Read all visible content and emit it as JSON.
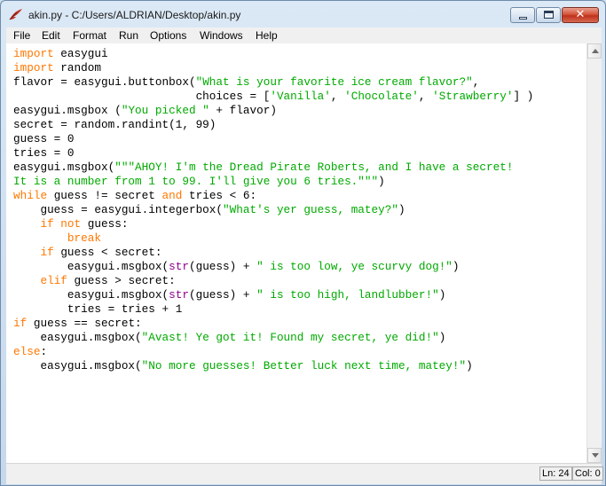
{
  "window": {
    "title": "akin.py - C:/Users/ALDRIAN/Desktop/akin.py",
    "app_icon": "idle-feather-icon",
    "controls": {
      "minimize": "minimize-icon",
      "maximize": "maximize-icon",
      "close": "close-icon"
    }
  },
  "menubar": {
    "items": [
      "File",
      "Edit",
      "Format",
      "Run",
      "Options",
      "Windows",
      "Help"
    ]
  },
  "editor": {
    "colors": {
      "keyword": "#ff7700",
      "string": "#00aa00",
      "builtin": "#900090",
      "default": "#000000"
    },
    "lines": [
      [
        [
          "kw",
          "import"
        ],
        [
          "t",
          " easygui"
        ]
      ],
      [
        [
          "kw",
          "import"
        ],
        [
          "t",
          " random"
        ]
      ],
      [
        [
          "t",
          "flavor = easygui.buttonbox("
        ],
        [
          "st",
          "\"What is your favorite ice cream flavor?\""
        ],
        [
          "t",
          ","
        ]
      ],
      [
        [
          "t",
          "                           choices = ["
        ],
        [
          "st",
          "'Vanilla'"
        ],
        [
          "t",
          ", "
        ],
        [
          "st",
          "'Chocolate'"
        ],
        [
          "t",
          ", "
        ],
        [
          "st",
          "'Strawberry'"
        ],
        [
          "t",
          "] )"
        ]
      ],
      [
        [
          "t",
          "easygui.msgbox ("
        ],
        [
          "st",
          "\"You picked \""
        ],
        [
          "t",
          " + flavor)"
        ]
      ],
      [
        [
          "t",
          "secret = random.randint(1, 99)"
        ]
      ],
      [
        [
          "t",
          "guess = 0"
        ]
      ],
      [
        [
          "t",
          "tries = 0"
        ]
      ],
      [
        [
          "t",
          "easygui.msgbox("
        ],
        [
          "st",
          "\"\"\"AHOY! I'm the Dread Pirate Roberts, and I have a secret!"
        ]
      ],
      [
        [
          "st",
          "It is a number from 1 to 99. I'll give you 6 tries.\"\"\""
        ],
        [
          "t",
          ")"
        ]
      ],
      [
        [
          "kw",
          "while"
        ],
        [
          "t",
          " guess != secret "
        ],
        [
          "kw",
          "and"
        ],
        [
          "t",
          " tries < 6:"
        ]
      ],
      [
        [
          "t",
          "    guess = easygui.integerbox("
        ],
        [
          "st",
          "\"What's yer guess, matey?\""
        ],
        [
          "t",
          ")"
        ]
      ],
      [
        [
          "t",
          "    "
        ],
        [
          "kw",
          "if not"
        ],
        [
          "t",
          " guess:"
        ]
      ],
      [
        [
          "t",
          "        "
        ],
        [
          "kw",
          "break"
        ]
      ],
      [
        [
          "t",
          "    "
        ],
        [
          "kw",
          "if"
        ],
        [
          "t",
          " guess < secret:"
        ]
      ],
      [
        [
          "t",
          "        easygui.msgbox("
        ],
        [
          "bi",
          "str"
        ],
        [
          "t",
          "(guess) + "
        ],
        [
          "st",
          "\" is too low, ye scurvy dog!\""
        ],
        [
          "t",
          ")"
        ]
      ],
      [
        [
          "t",
          "    "
        ],
        [
          "kw",
          "elif"
        ],
        [
          "t",
          " guess > secret:"
        ]
      ],
      [
        [
          "t",
          "        easygui.msgbox("
        ],
        [
          "bi",
          "str"
        ],
        [
          "t",
          "(guess) + "
        ],
        [
          "st",
          "\" is too high, landlubber!\""
        ],
        [
          "t",
          ")"
        ]
      ],
      [
        [
          "t",
          "        tries = tries + 1"
        ]
      ],
      [
        [
          "kw",
          "if"
        ],
        [
          "t",
          " guess == secret:"
        ]
      ],
      [
        [
          "t",
          "    easygui.msgbox("
        ],
        [
          "st",
          "\"Avast! Ye got it! Found my secret, ye did!\""
        ],
        [
          "t",
          ")"
        ]
      ],
      [
        [
          "kw",
          "else"
        ],
        [
          "t",
          ":"
        ]
      ],
      [
        [
          "t",
          "    easygui.msgbox("
        ],
        [
          "st",
          "\"No more guesses! Better luck next time, matey!\""
        ],
        [
          "t",
          ")"
        ]
      ]
    ]
  },
  "scrollbar": {
    "up_icon": "scroll-up-arrow-icon",
    "down_icon": "scroll-down-arrow-icon"
  },
  "statusbar": {
    "line": "Ln: 24",
    "col": "Col: 0"
  }
}
